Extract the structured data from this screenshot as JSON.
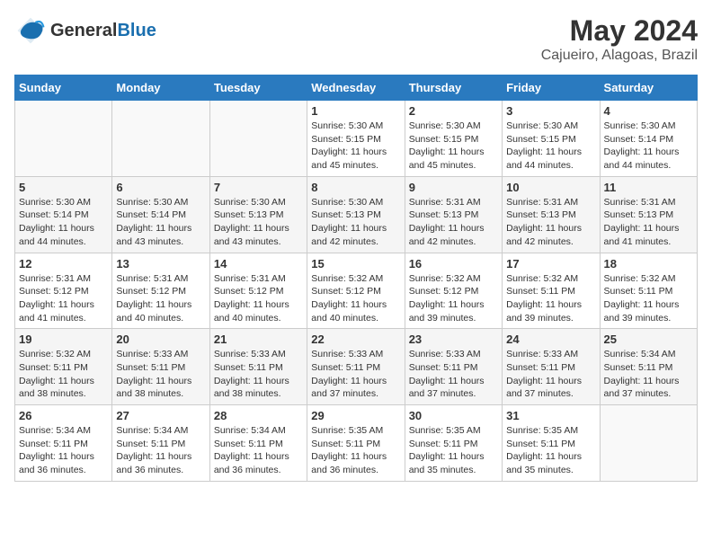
{
  "header": {
    "logo_general": "General",
    "logo_blue": "Blue",
    "month": "May 2024",
    "location": "Cajueiro, Alagoas, Brazil"
  },
  "days_of_week": [
    "Sunday",
    "Monday",
    "Tuesday",
    "Wednesday",
    "Thursday",
    "Friday",
    "Saturday"
  ],
  "weeks": [
    [
      {
        "day": "",
        "info": ""
      },
      {
        "day": "",
        "info": ""
      },
      {
        "day": "",
        "info": ""
      },
      {
        "day": "1",
        "info": "Sunrise: 5:30 AM\nSunset: 5:15 PM\nDaylight: 11 hours\nand 45 minutes."
      },
      {
        "day": "2",
        "info": "Sunrise: 5:30 AM\nSunset: 5:15 PM\nDaylight: 11 hours\nand 45 minutes."
      },
      {
        "day": "3",
        "info": "Sunrise: 5:30 AM\nSunset: 5:15 PM\nDaylight: 11 hours\nand 44 minutes."
      },
      {
        "day": "4",
        "info": "Sunrise: 5:30 AM\nSunset: 5:14 PM\nDaylight: 11 hours\nand 44 minutes."
      }
    ],
    [
      {
        "day": "5",
        "info": "Sunrise: 5:30 AM\nSunset: 5:14 PM\nDaylight: 11 hours\nand 44 minutes."
      },
      {
        "day": "6",
        "info": "Sunrise: 5:30 AM\nSunset: 5:14 PM\nDaylight: 11 hours\nand 43 minutes."
      },
      {
        "day": "7",
        "info": "Sunrise: 5:30 AM\nSunset: 5:13 PM\nDaylight: 11 hours\nand 43 minutes."
      },
      {
        "day": "8",
        "info": "Sunrise: 5:30 AM\nSunset: 5:13 PM\nDaylight: 11 hours\nand 42 minutes."
      },
      {
        "day": "9",
        "info": "Sunrise: 5:31 AM\nSunset: 5:13 PM\nDaylight: 11 hours\nand 42 minutes."
      },
      {
        "day": "10",
        "info": "Sunrise: 5:31 AM\nSunset: 5:13 PM\nDaylight: 11 hours\nand 42 minutes."
      },
      {
        "day": "11",
        "info": "Sunrise: 5:31 AM\nSunset: 5:13 PM\nDaylight: 11 hours\nand 41 minutes."
      }
    ],
    [
      {
        "day": "12",
        "info": "Sunrise: 5:31 AM\nSunset: 5:12 PM\nDaylight: 11 hours\nand 41 minutes."
      },
      {
        "day": "13",
        "info": "Sunrise: 5:31 AM\nSunset: 5:12 PM\nDaylight: 11 hours\nand 40 minutes."
      },
      {
        "day": "14",
        "info": "Sunrise: 5:31 AM\nSunset: 5:12 PM\nDaylight: 11 hours\nand 40 minutes."
      },
      {
        "day": "15",
        "info": "Sunrise: 5:32 AM\nSunset: 5:12 PM\nDaylight: 11 hours\nand 40 minutes."
      },
      {
        "day": "16",
        "info": "Sunrise: 5:32 AM\nSunset: 5:12 PM\nDaylight: 11 hours\nand 39 minutes."
      },
      {
        "day": "17",
        "info": "Sunrise: 5:32 AM\nSunset: 5:11 PM\nDaylight: 11 hours\nand 39 minutes."
      },
      {
        "day": "18",
        "info": "Sunrise: 5:32 AM\nSunset: 5:11 PM\nDaylight: 11 hours\nand 39 minutes."
      }
    ],
    [
      {
        "day": "19",
        "info": "Sunrise: 5:32 AM\nSunset: 5:11 PM\nDaylight: 11 hours\nand 38 minutes."
      },
      {
        "day": "20",
        "info": "Sunrise: 5:33 AM\nSunset: 5:11 PM\nDaylight: 11 hours\nand 38 minutes."
      },
      {
        "day": "21",
        "info": "Sunrise: 5:33 AM\nSunset: 5:11 PM\nDaylight: 11 hours\nand 38 minutes."
      },
      {
        "day": "22",
        "info": "Sunrise: 5:33 AM\nSunset: 5:11 PM\nDaylight: 11 hours\nand 37 minutes."
      },
      {
        "day": "23",
        "info": "Sunrise: 5:33 AM\nSunset: 5:11 PM\nDaylight: 11 hours\nand 37 minutes."
      },
      {
        "day": "24",
        "info": "Sunrise: 5:33 AM\nSunset: 5:11 PM\nDaylight: 11 hours\nand 37 minutes."
      },
      {
        "day": "25",
        "info": "Sunrise: 5:34 AM\nSunset: 5:11 PM\nDaylight: 11 hours\nand 37 minutes."
      }
    ],
    [
      {
        "day": "26",
        "info": "Sunrise: 5:34 AM\nSunset: 5:11 PM\nDaylight: 11 hours\nand 36 minutes."
      },
      {
        "day": "27",
        "info": "Sunrise: 5:34 AM\nSunset: 5:11 PM\nDaylight: 11 hours\nand 36 minutes."
      },
      {
        "day": "28",
        "info": "Sunrise: 5:34 AM\nSunset: 5:11 PM\nDaylight: 11 hours\nand 36 minutes."
      },
      {
        "day": "29",
        "info": "Sunrise: 5:35 AM\nSunset: 5:11 PM\nDaylight: 11 hours\nand 36 minutes."
      },
      {
        "day": "30",
        "info": "Sunrise: 5:35 AM\nSunset: 5:11 PM\nDaylight: 11 hours\nand 35 minutes."
      },
      {
        "day": "31",
        "info": "Sunrise: 5:35 AM\nSunset: 5:11 PM\nDaylight: 11 hours\nand 35 minutes."
      },
      {
        "day": "",
        "info": ""
      }
    ]
  ]
}
